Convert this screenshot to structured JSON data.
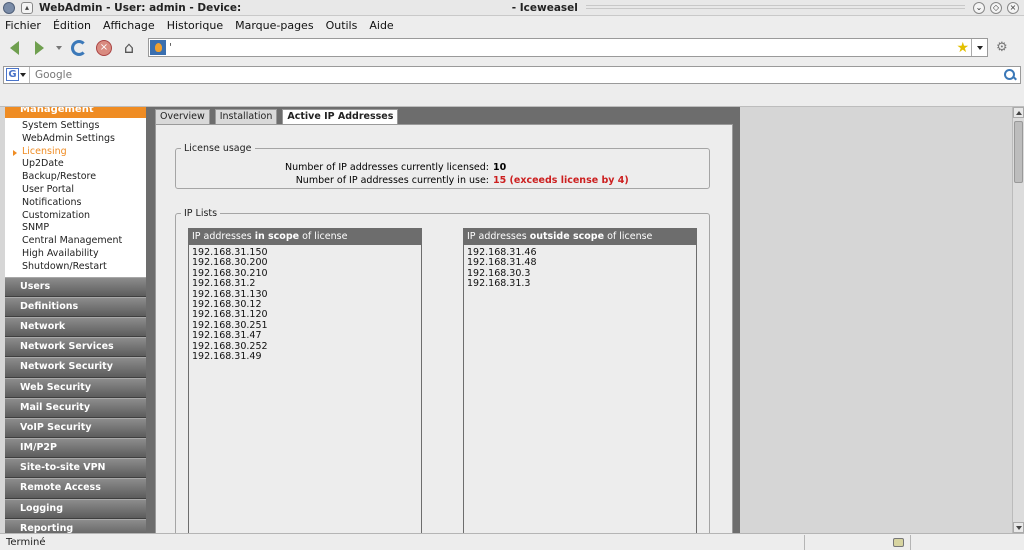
{
  "window": {
    "title": "WebAdmin - User: admin - Device:",
    "app": "- Iceweasel"
  },
  "menubar": [
    "Fichier",
    "Édition",
    "Affichage",
    "Historique",
    "Marque-pages",
    "Outils",
    "Aide"
  ],
  "navbar": {
    "url": "'"
  },
  "search": {
    "placeholder": "Google",
    "engine_letter": "G"
  },
  "sidebar": {
    "section": "Management",
    "items": [
      {
        "label": "System Settings",
        "active": false
      },
      {
        "label": "WebAdmin Settings",
        "active": false
      },
      {
        "label": "Licensing",
        "active": true
      },
      {
        "label": "Up2Date",
        "active": false
      },
      {
        "label": "Backup/Restore",
        "active": false
      },
      {
        "label": "User Portal",
        "active": false
      },
      {
        "label": "Notifications",
        "active": false
      },
      {
        "label": "Customization",
        "active": false
      },
      {
        "label": "SNMP",
        "active": false
      },
      {
        "label": "Central Management",
        "active": false
      },
      {
        "label": "High Availability",
        "active": false
      },
      {
        "label": "Shutdown/Restart",
        "active": false
      }
    ],
    "categories": [
      "Users",
      "Definitions",
      "Network",
      "Network Services",
      "Network Security",
      "Web Security",
      "Mail Security",
      "VoIP Security",
      "IM/P2P",
      "Site-to-site VPN",
      "Remote Access",
      "Logging",
      "Reporting"
    ]
  },
  "tabs": [
    {
      "label": "Overview",
      "active": false
    },
    {
      "label": "Installation",
      "active": false
    },
    {
      "label": "Active IP Addresses",
      "active": true
    }
  ],
  "license_usage": {
    "legend": "License usage",
    "licensed_label": "Number of IP addresses currently licensed:",
    "licensed_value": "10",
    "in_use_label": "Number of IP addresses currently in use:",
    "in_use_value": "15 (exceeds license by 4)"
  },
  "ip_lists": {
    "legend": "IP Lists",
    "in_scope": {
      "title_pre": "IP addresses ",
      "title_bold": "in scope",
      "title_post": " of license",
      "ips": [
        "192.168.31.150",
        "192.168.30.200",
        "192.168.30.210",
        "192.168.31.2",
        "192.168.31.130",
        "192.168.30.12",
        "192.168.31.120",
        "192.168.30.251",
        "192.168.31.47",
        "192.168.30.252",
        "192.168.31.49"
      ]
    },
    "out_scope": {
      "title_pre": "IP addresses ",
      "title_bold": "outside scope",
      "title_post": " of license",
      "ips": [
        "192.168.31.46",
        "192.168.31.48",
        "192.168.30.3",
        "192.168.31.3"
      ]
    }
  },
  "statusbar": {
    "text": "Terminé"
  },
  "colors": {
    "accent": "#ef8c23",
    "warning": "#cc1f1f",
    "panel_dark": "#6d6d6d"
  }
}
